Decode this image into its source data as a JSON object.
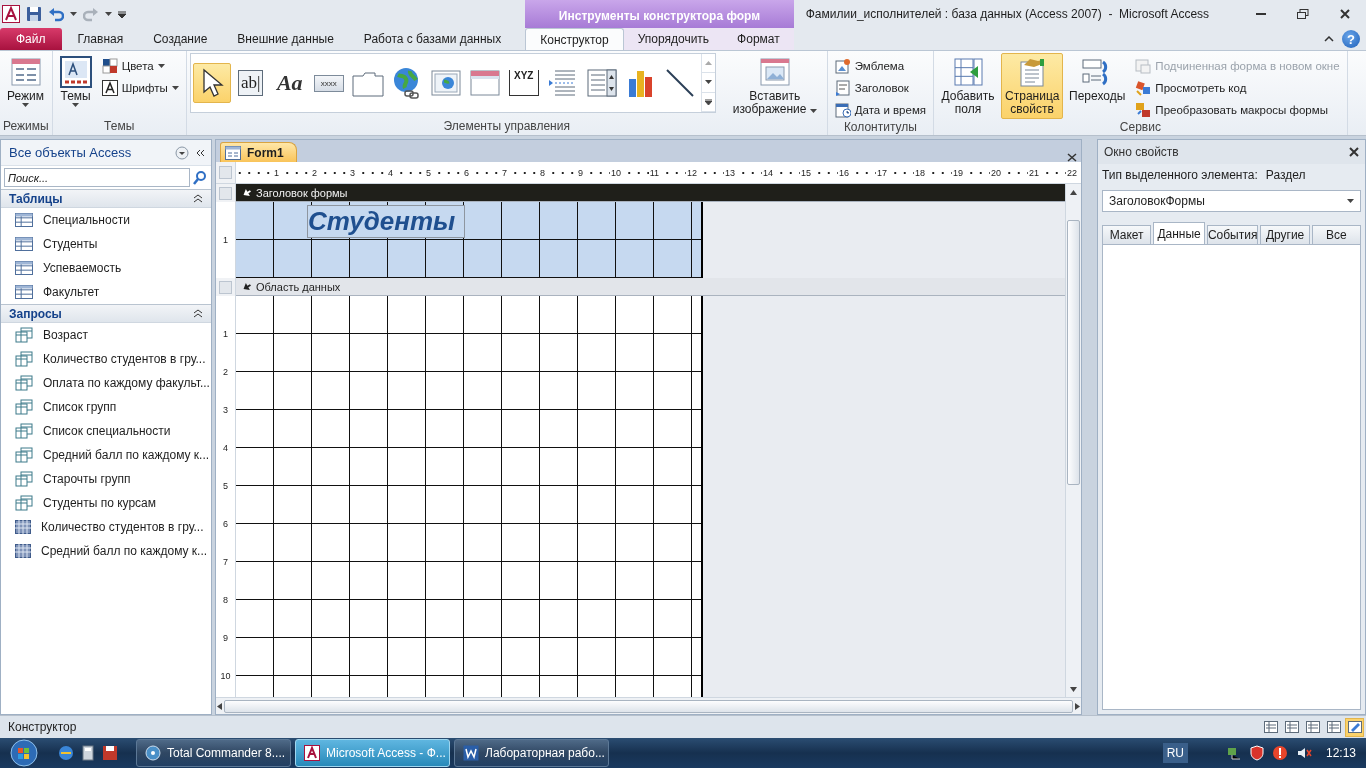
{
  "title_bar": {
    "title": "Фамилии_исполнителей : база данных (Access 2007)  -  Microsoft Access",
    "context_group": "Инструменты конструктора форм",
    "help_glyph": "?"
  },
  "ribbon_tabs": [
    {
      "label": "Файл",
      "kind": "file",
      "selected": false
    },
    {
      "label": "Главная",
      "kind": "normal",
      "selected": false
    },
    {
      "label": "Создание",
      "kind": "normal",
      "selected": false
    },
    {
      "label": "Внешние данные",
      "kind": "normal",
      "selected": false
    },
    {
      "label": "Работа с базами данных",
      "kind": "normal",
      "selected": false
    },
    {
      "label": "Конструктор",
      "kind": "contextual",
      "selected": true
    },
    {
      "label": "Упорядочить",
      "kind": "contextual",
      "selected": false
    },
    {
      "label": "Формат",
      "kind": "contextual",
      "selected": false
    }
  ],
  "ribbon_groups": [
    {
      "label": "Режимы",
      "items": [
        {
          "kind": "view",
          "label": "Режим",
          "dropdown": true,
          "selected": false,
          "disabled": false
        }
      ]
    },
    {
      "label": "Темы",
      "items": [
        {
          "kind": "themes",
          "label": "Темы",
          "dropdown": true,
          "selected": false,
          "disabled": false
        },
        {
          "kind": "colors",
          "label": "Цвета",
          "dropdown": true,
          "selected": false,
          "disabled": false
        },
        {
          "kind": "fonts",
          "label": "Шрифты",
          "dropdown": true,
          "selected": false,
          "disabled": false
        }
      ]
    },
    {
      "label": "Элементы управления",
      "gallery": [
        {
          "kind": "pointer",
          "selected": true
        },
        {
          "kind": "textbox",
          "glyph": "ab|",
          "selected": false
        },
        {
          "kind": "label",
          "glyph": "Aa",
          "selected": false
        },
        {
          "kind": "button",
          "glyph": "xxxx",
          "selected": false
        },
        {
          "kind": "tab",
          "selected": false
        },
        {
          "kind": "hyperlink",
          "selected": false
        },
        {
          "kind": "browser",
          "selected": false
        },
        {
          "kind": "navigation",
          "selected": false
        },
        {
          "kind": "group",
          "glyph": "XYZ",
          "selected": false
        },
        {
          "kind": "pagebreak",
          "selected": false
        },
        {
          "kind": "combo",
          "selected": false
        },
        {
          "kind": "chart",
          "selected": false
        },
        {
          "kind": "line",
          "selected": false
        }
      ],
      "items": [
        {
          "kind": "insert-image",
          "label": "Вставить изображение",
          "dropdown": true,
          "selected": false,
          "disabled": false
        }
      ]
    },
    {
      "label": "Колонтитулы",
      "items": [
        {
          "kind": "logo",
          "label": "Эмблема",
          "dropdown": false,
          "selected": false,
          "disabled": false
        },
        {
          "kind": "title",
          "label": "Заголовок",
          "dropdown": false,
          "selected": false,
          "disabled": false
        },
        {
          "kind": "datetime",
          "label": "Дата и время",
          "dropdown": false,
          "selected": false,
          "disabled": false
        }
      ]
    },
    {
      "label": "Сервис",
      "items": [
        {
          "kind": "add-fields",
          "label": "Добавить поля",
          "dropdown": false,
          "selected": false,
          "disabled": false
        },
        {
          "kind": "property-sheet",
          "label": "Страница свойств",
          "dropdown": false,
          "selected": true,
          "disabled": false
        },
        {
          "kind": "tab-order",
          "label": "Переходы",
          "dropdown": false,
          "selected": false,
          "disabled": false
        },
        {
          "kind": "subform",
          "label": "Подчиненная форма в новом окне",
          "dropdown": false,
          "selected": false,
          "disabled": true
        },
        {
          "kind": "view-code",
          "label": "Просмотреть код",
          "dropdown": false,
          "selected": false,
          "disabled": false
        },
        {
          "kind": "convert-macros",
          "label": "Преобразовать макросы формы",
          "dropdown": false,
          "selected": false,
          "disabled": false
        }
      ]
    }
  ],
  "nav_pane": {
    "title": "Все объекты Access",
    "search": {
      "placeholder": "Поиск..."
    },
    "groups": [
      {
        "label": "Таблицы",
        "expanded": true,
        "items": [
          {
            "label": "Специальности",
            "kind": "table"
          },
          {
            "label": "Студенты",
            "kind": "table"
          },
          {
            "label": "Успеваемость",
            "kind": "table"
          },
          {
            "label": "Факультет",
            "kind": "table"
          }
        ]
      },
      {
        "label": "Запросы",
        "expanded": true,
        "items": [
          {
            "label": "Возраст",
            "kind": "query"
          },
          {
            "label": "Количество студентов в гру...",
            "kind": "query"
          },
          {
            "label": "Оплата по каждому факульт...",
            "kind": "query"
          },
          {
            "label": "Список групп",
            "kind": "query"
          },
          {
            "label": "Список специальности",
            "kind": "query"
          },
          {
            "label": "Средний балл по каждому к...",
            "kind": "query"
          },
          {
            "label": "Старочты групп",
            "kind": "query"
          },
          {
            "label": "Студенты по курсам",
            "kind": "query"
          },
          {
            "label": "Количество студентов в гру...",
            "kind": "crosstab"
          },
          {
            "label": "Средний балл по каждому к...",
            "kind": "crosstab"
          }
        ]
      }
    ]
  },
  "document": {
    "tab": "Form1",
    "ruler_marks": [
      "1",
      "2",
      "3",
      "4",
      "5",
      "6",
      "7",
      "8",
      "9",
      "10",
      "11",
      "12",
      "13",
      "14",
      "15",
      "16",
      "17",
      "18",
      "19",
      "20",
      "21",
      "22"
    ],
    "sections": [
      {
        "label": "Заголовок формы",
        "selected": true,
        "ruler_marks": [
          "1"
        ],
        "controls": [
          {
            "kind": "label",
            "text": "Студенты"
          }
        ]
      },
      {
        "label": "Область данных",
        "selected": false,
        "ruler_marks": [
          "1",
          "2",
          "3",
          "4",
          "5",
          "6",
          "7",
          "8",
          "9",
          "10"
        ]
      }
    ]
  },
  "property_sheet": {
    "title": "Окно свойств",
    "selection_type_label": "Тип выделенного элемента:",
    "selection_type": "Раздел",
    "object": "ЗаголовокФормы",
    "tabs": [
      {
        "label": "Макет",
        "selected": false
      },
      {
        "label": "Данные",
        "selected": true
      },
      {
        "label": "События",
        "selected": false
      },
      {
        "label": "Другие",
        "selected": false
      },
      {
        "label": "Все",
        "selected": false
      }
    ]
  },
  "status_bar": {
    "text": "Конструктор",
    "views": [
      {
        "kind": "form",
        "selected": false
      },
      {
        "kind": "datasheet",
        "selected": false
      },
      {
        "kind": "pivot",
        "selected": false
      },
      {
        "kind": "layout",
        "selected": false
      },
      {
        "kind": "design",
        "selected": true
      }
    ]
  },
  "taskbar": {
    "tasks": [
      {
        "label": "Total Commander 8....",
        "kind": "commander",
        "selected": false
      },
      {
        "label": "Microsoft Access - Ф...",
        "kind": "access",
        "selected": true
      },
      {
        "label": "Лабораторная рабо...",
        "kind": "word",
        "selected": false
      }
    ],
    "language": "RU",
    "clock": "12:13"
  }
}
